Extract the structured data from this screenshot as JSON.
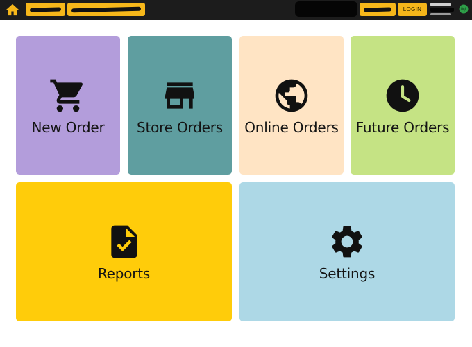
{
  "topbar": {
    "login_label": "LOGIN",
    "home_icon": "home-icon",
    "status_icon": "globe-icon",
    "accent": "#f6b71a"
  },
  "tiles": [
    {
      "label": "New Order",
      "icon": "cart-icon",
      "color": "#b39ddb"
    },
    {
      "label": "Store Orders",
      "icon": "store-icon",
      "color": "#5f9ea0"
    },
    {
      "label": "Online Orders",
      "icon": "globe-icon",
      "color": "#ffe4c4"
    },
    {
      "label": "Future Orders",
      "icon": "clock-icon",
      "color": "#c5e384"
    },
    {
      "label": "Reports",
      "icon": "report-icon",
      "color": "#ffcc0a"
    },
    {
      "label": "Settings",
      "icon": "gear-icon",
      "color": "#add8e6"
    }
  ]
}
